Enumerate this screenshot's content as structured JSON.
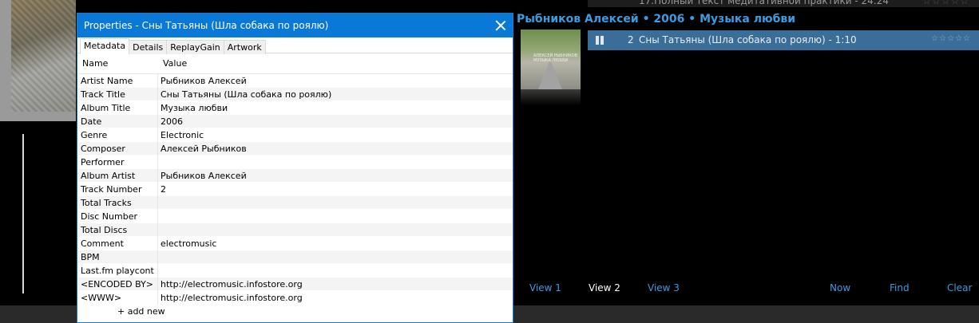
{
  "player": {
    "top_track_text": "17.Полный текст медитативной практики - 24:24",
    "group_header": "Рыбников Алексей • 2006 • Музыка любви",
    "album_cover_text": "АЛЕКСЕЙ РЫБНИКОВ МУЗЫКА ЛЮБВИ",
    "now_playing": {
      "number": "2",
      "title": "Сны Татьяны (Шла собака по роялю) - 1:10",
      "rating_stars": "☆☆☆☆☆"
    },
    "top_stars": "☆☆☆☆☆",
    "nav": {
      "view1": "View 1",
      "view2": "View 2",
      "view3": "View 3",
      "now": "Now",
      "find": "Find",
      "clear": "Clear"
    },
    "active_view": "View 2",
    "accent_color": "#3d9be0",
    "highlight_row_color": "#3a6e98"
  },
  "dialog": {
    "title": "Properties - Сны Татьяны (Шла собака по роялю)",
    "title_bar_color": "#0a78d7",
    "tabs": [
      "Metadata",
      "Details",
      "ReplayGain",
      "Artwork"
    ],
    "active_tab": "Metadata",
    "columns": {
      "name": "Name",
      "value": "Value"
    },
    "rows": [
      {
        "name": "Artist Name",
        "value": "Рыбников Алексей"
      },
      {
        "name": "Track Title",
        "value": "Сны Татьяны (Шла собака по роялю)"
      },
      {
        "name": "Album Title",
        "value": "Музыка любви"
      },
      {
        "name": "Date",
        "value": "2006"
      },
      {
        "name": "Genre",
        "value": "Electronic"
      },
      {
        "name": "Composer",
        "value": "Алексей Рыбников"
      },
      {
        "name": "Performer",
        "value": ""
      },
      {
        "name": "Album Artist",
        "value": "Рыбников Алексей"
      },
      {
        "name": "Track Number",
        "value": "2"
      },
      {
        "name": "Total Tracks",
        "value": ""
      },
      {
        "name": "Disc Number",
        "value": ""
      },
      {
        "name": "Total Discs",
        "value": ""
      },
      {
        "name": "Comment",
        "value": "electromusic"
      },
      {
        "name": "BPM",
        "value": ""
      },
      {
        "name": "Last.fm playcont",
        "value": ""
      },
      {
        "name": "<ENCODED BY>",
        "value": "http://electromusic.infostore.org"
      },
      {
        "name": "<WWW>",
        "value": "http://electromusic.infostore.org"
      }
    ],
    "add_new_label": "+ add new"
  }
}
